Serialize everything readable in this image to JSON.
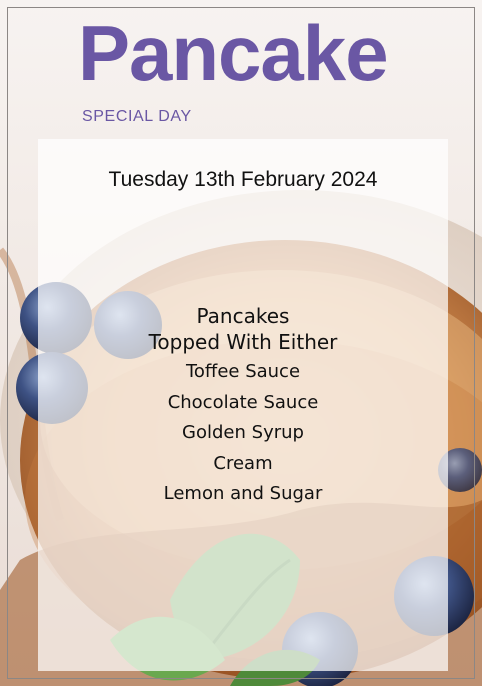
{
  "poster": {
    "title": "Pancake",
    "subtitle": "SPECIAL DAY",
    "date": "Tuesday 13th February 2024",
    "menu": {
      "heading_line1": "Pancakes",
      "heading_line2": "Topped With Either",
      "items": [
        "Toffee Sauce",
        "Chocolate Sauce",
        "Golden Syrup",
        "Cream",
        "Lemon and Sugar"
      ]
    }
  },
  "colors": {
    "brand_purple": "#6a57a4",
    "text": "#111111",
    "panel": "#ffffff"
  }
}
